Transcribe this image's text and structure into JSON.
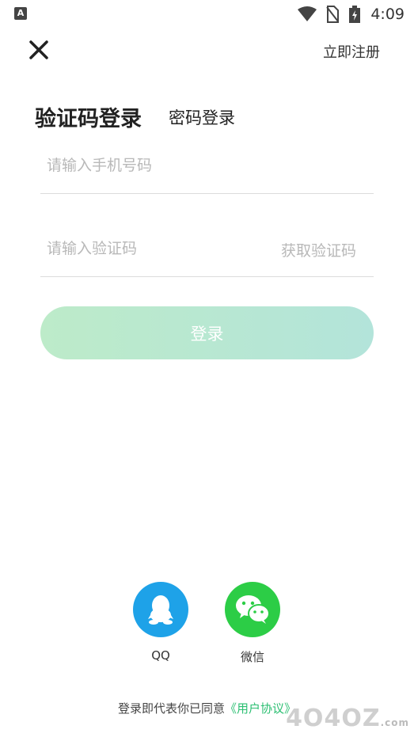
{
  "status_bar": {
    "time": "4:09",
    "app_icon": "A"
  },
  "header": {
    "close_icon": "close-icon",
    "register_label": "立即注册"
  },
  "tabs": {
    "active": "验证码登录",
    "inactive": "密码登录"
  },
  "form": {
    "phone_placeholder": "请输入手机号码",
    "code_placeholder": "请输入验证码",
    "get_code_label": "获取验证码",
    "login_label": "登录"
  },
  "social": {
    "qq_label": "QQ",
    "wechat_label": "微信"
  },
  "agreement": {
    "prefix": "登录即代表你已同意",
    "link": "《用户协议》"
  },
  "watermark": {
    "text": "4O4OZ",
    "suffix": ".com"
  },
  "colors": {
    "accent": "#2bbf72",
    "qq": "#1ea2e8",
    "wechat": "#2ccd46",
    "button_start": "#bdebc9",
    "button_end": "#b3e4da"
  }
}
